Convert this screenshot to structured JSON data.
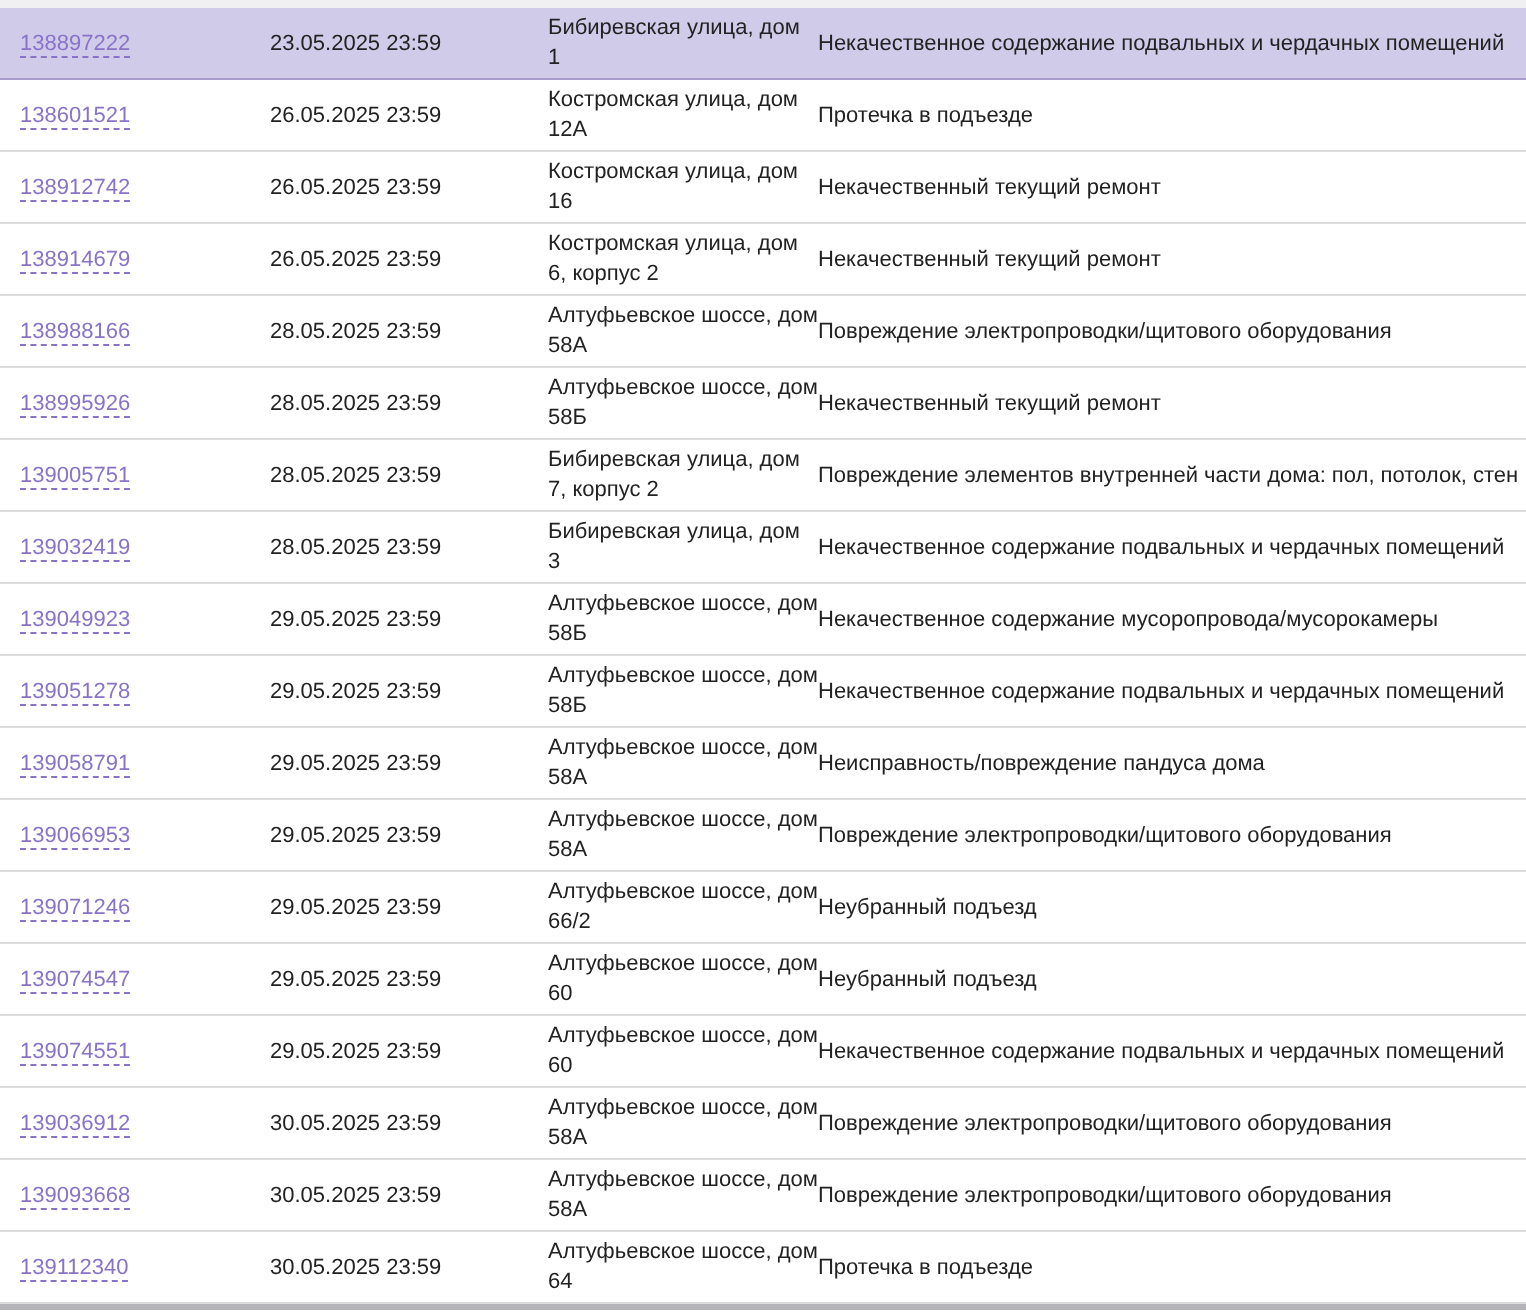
{
  "table": {
    "rows": [
      {
        "number": "138897222",
        "date": "23.05.2025 23:59",
        "address": "Бибиревская улица, дом 1",
        "issue": "Некачественное содержание подвальных и чердачных помещений",
        "selected": true
      },
      {
        "number": "138601521",
        "date": "26.05.2025 23:59",
        "address": "Костромская улица, дом 12А",
        "issue": "Протечка в подъезде",
        "selected": false
      },
      {
        "number": "138912742",
        "date": "26.05.2025 23:59",
        "address": "Костромская улица, дом 16",
        "issue": "Некачественный текущий ремонт",
        "selected": false
      },
      {
        "number": "138914679",
        "date": "26.05.2025 23:59",
        "address": "Костромская улица, дом 6, корпус 2",
        "issue": "Некачественный текущий ремонт",
        "selected": false
      },
      {
        "number": "138988166",
        "date": "28.05.2025 23:59",
        "address": "Алтуфьевское шоссе, дом 58А",
        "issue": "Повреждение электропроводки/щитового оборудования",
        "selected": false
      },
      {
        "number": "138995926",
        "date": "28.05.2025 23:59",
        "address": "Алтуфьевское шоссе, дом 58Б",
        "issue": "Некачественный текущий ремонт",
        "selected": false
      },
      {
        "number": "139005751",
        "date": "28.05.2025 23:59",
        "address": "Бибиревская улица, дом 7, корпус 2",
        "issue": "Повреждение элементов внутренней части дома: пол, потолок, стен",
        "selected": false
      },
      {
        "number": "139032419",
        "date": "28.05.2025 23:59",
        "address": "Бибиревская улица, дом 3",
        "issue": "Некачественное содержание подвальных и чердачных помещений",
        "selected": false
      },
      {
        "number": "139049923",
        "date": "29.05.2025 23:59",
        "address": "Алтуфьевское шоссе, дом 58Б",
        "issue": "Некачественное содержание мусоропровода/мусорокамеры",
        "selected": false
      },
      {
        "number": "139051278",
        "date": "29.05.2025 23:59",
        "address": "Алтуфьевское шоссе, дом 58Б",
        "issue": "Некачественное содержание подвальных и чердачных помещений",
        "selected": false
      },
      {
        "number": "139058791",
        "date": "29.05.2025 23:59",
        "address": "Алтуфьевское шоссе, дом 58А",
        "issue": "Неисправность/повреждение пандуса дома",
        "selected": false
      },
      {
        "number": "139066953",
        "date": "29.05.2025 23:59",
        "address": "Алтуфьевское шоссе, дом 58А",
        "issue": "Повреждение электропроводки/щитового оборудования",
        "selected": false
      },
      {
        "number": "139071246",
        "date": "29.05.2025 23:59",
        "address": "Алтуфьевское шоссе, дом 66/2",
        "issue": "Неубранный подъезд",
        "selected": false
      },
      {
        "number": "139074547",
        "date": "29.05.2025 23:59",
        "address": "Алтуфьевское шоссе, дом 60",
        "issue": "Неубранный подъезд",
        "selected": false
      },
      {
        "number": "139074551",
        "date": "29.05.2025 23:59",
        "address": "Алтуфьевское шоссе, дом 60",
        "issue": "Некачественное содержание подвальных и чердачных помещений",
        "selected": false
      },
      {
        "number": "139036912",
        "date": "30.05.2025 23:59",
        "address": "Алтуфьевское шоссе, дом 58А",
        "issue": "Повреждение электропроводки/щитового оборудования",
        "selected": false
      },
      {
        "number": "139093668",
        "date": "30.05.2025 23:59",
        "address": "Алтуфьевское шоссе, дом 58А",
        "issue": "Повреждение электропроводки/щитового оборудования",
        "selected": false
      },
      {
        "number": "139112340",
        "date": "30.05.2025 23:59",
        "address": "Алтуфьевское шоссе, дом 64",
        "issue": "Протечка в подъезде",
        "selected": false
      }
    ]
  }
}
